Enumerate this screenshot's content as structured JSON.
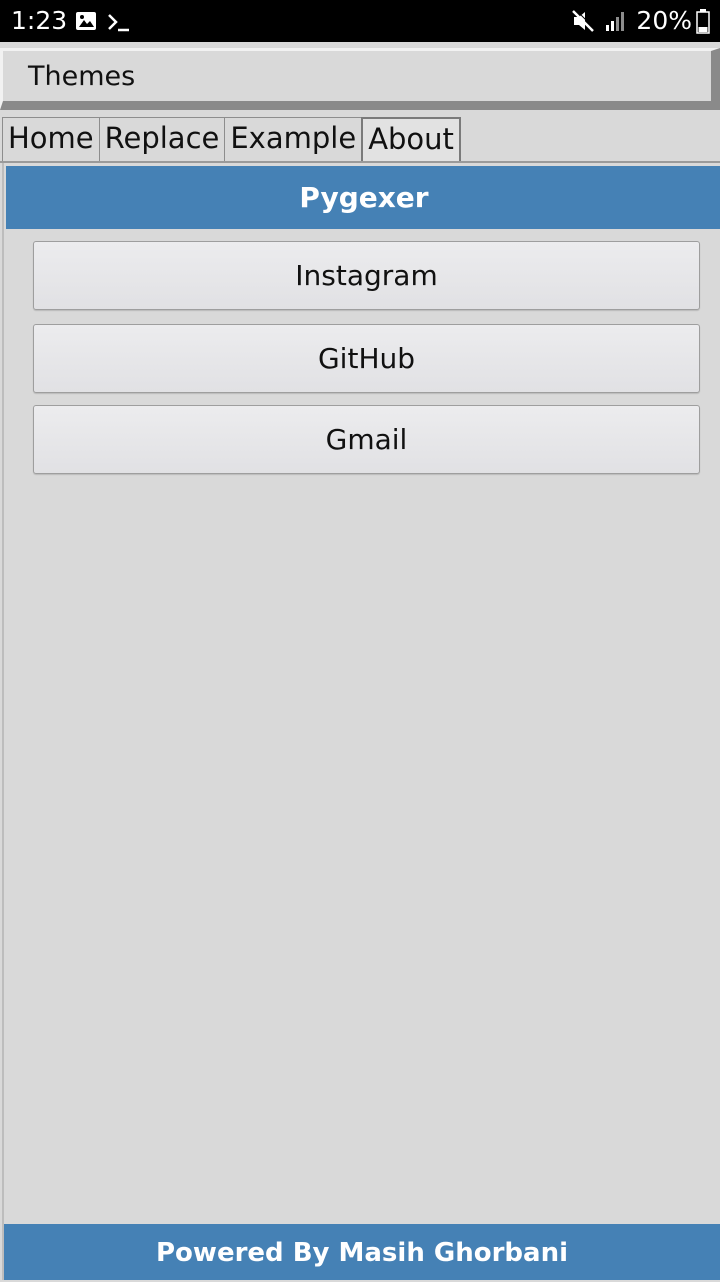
{
  "status_bar": {
    "time": "1:23",
    "battery": "20%",
    "left_icons": [
      "image-icon",
      "terminal-icon"
    ],
    "right_icons": [
      "mute-icon",
      "signal-icon",
      "battery-icon"
    ]
  },
  "toolbar": {
    "themes_label": "Themes"
  },
  "tabs": [
    {
      "label": "Home",
      "active": false
    },
    {
      "label": "Replace",
      "active": false
    },
    {
      "label": "Example",
      "active": false
    },
    {
      "label": "About",
      "active": true
    }
  ],
  "panel": {
    "title": "Pygexer",
    "buttons": [
      {
        "label": "Instagram"
      },
      {
        "label": "GitHub"
      },
      {
        "label": "Gmail"
      }
    ]
  },
  "footer": {
    "text": "Powered By Masih Ghorbani"
  },
  "colors": {
    "accent": "#4581b5",
    "background": "#d9d9d9",
    "status_bar": "#000000"
  }
}
